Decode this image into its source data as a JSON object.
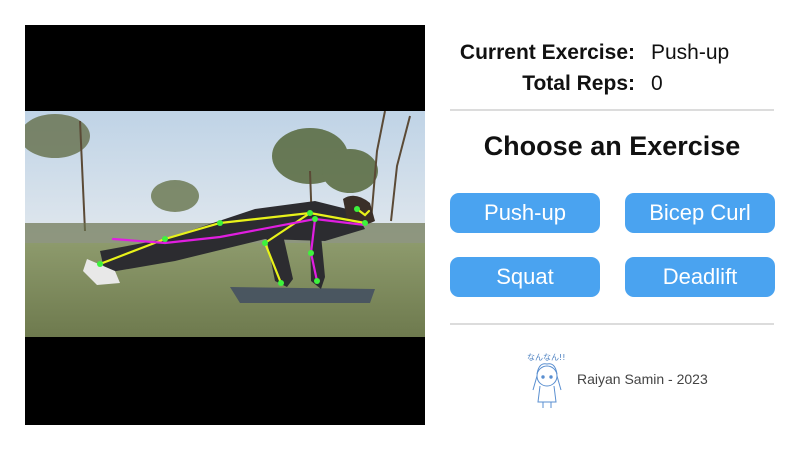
{
  "status": {
    "exercise_label": "Current Exercise:",
    "exercise_value": "Push-up",
    "reps_label": "Total Reps:",
    "reps_value": "0"
  },
  "chooser": {
    "title": "Choose an Exercise",
    "buttons": [
      "Push-up",
      "Bicep Curl",
      "Squat",
      "Deadlift"
    ]
  },
  "footer": {
    "credit": "Raiyan Samin - 2023",
    "mascot_text": "なんなん!!"
  },
  "colors": {
    "button_bg": "#4aa3f0",
    "skeleton_yellow": "#e8f21a",
    "skeleton_magenta": "#e01ee0",
    "joint_green": "#3df23d"
  }
}
